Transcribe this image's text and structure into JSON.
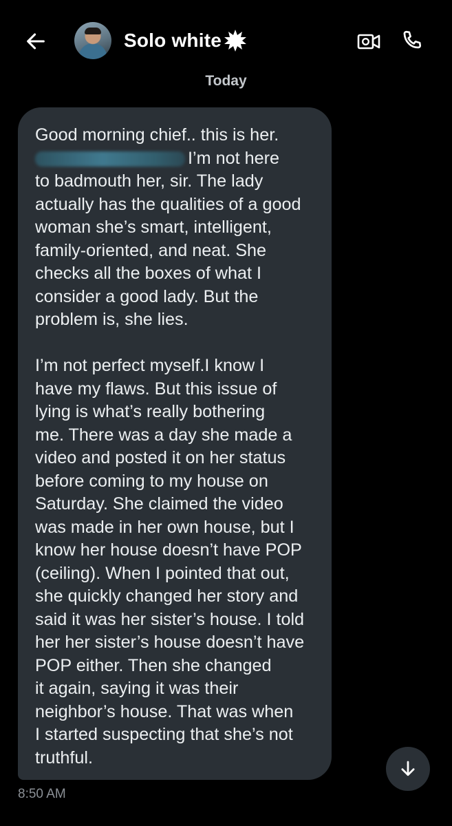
{
  "header": {
    "contact_name": "Solo white",
    "icons": {
      "back": "arrow-left-icon",
      "verified": "starburst-badge-icon",
      "video": "video-camera-icon",
      "call": "phone-icon"
    }
  },
  "conversation": {
    "date_separator": "Today",
    "messages": [
      {
        "paragraphs": [
          {
            "first_line": "Good morning chief.. this is her.",
            "redacted_line_tail": "I’m not here",
            "rest": "to badmouth her, sir. The lady\nactually has the qualities of a good\nwoman  she’s smart, intelligent,\nfamily-oriented, and neat. She\nchecks all the boxes of what I\nconsider a good lady. But the\nproblem is, she lies."
          },
          {
            "text": "I’m not perfect myself.I know I\nhave my flaws. But this issue of\nlying is what’s really bothering\nme. There was a day she made a\nvideo and posted it on her status\nbefore coming to my house on\nSaturday. She claimed the video\nwas made in her own house, but I\nknow her house doesn’t have POP\n(ceiling). When I pointed that out,\nshe quickly changed her story and\nsaid it was her sister’s house. I told\nher her sister’s house doesn’t have\nPOP either. Then she changed\nit again, saying it was their\nneighbor’s house. That was when\nI started suspecting that she’s not\ntruthful."
          }
        ],
        "timestamp": "8:50 AM"
      }
    ]
  },
  "colors": {
    "background": "#000000",
    "bubble": "#2a3036",
    "text": "#eceff1",
    "muted": "#8b9096"
  }
}
